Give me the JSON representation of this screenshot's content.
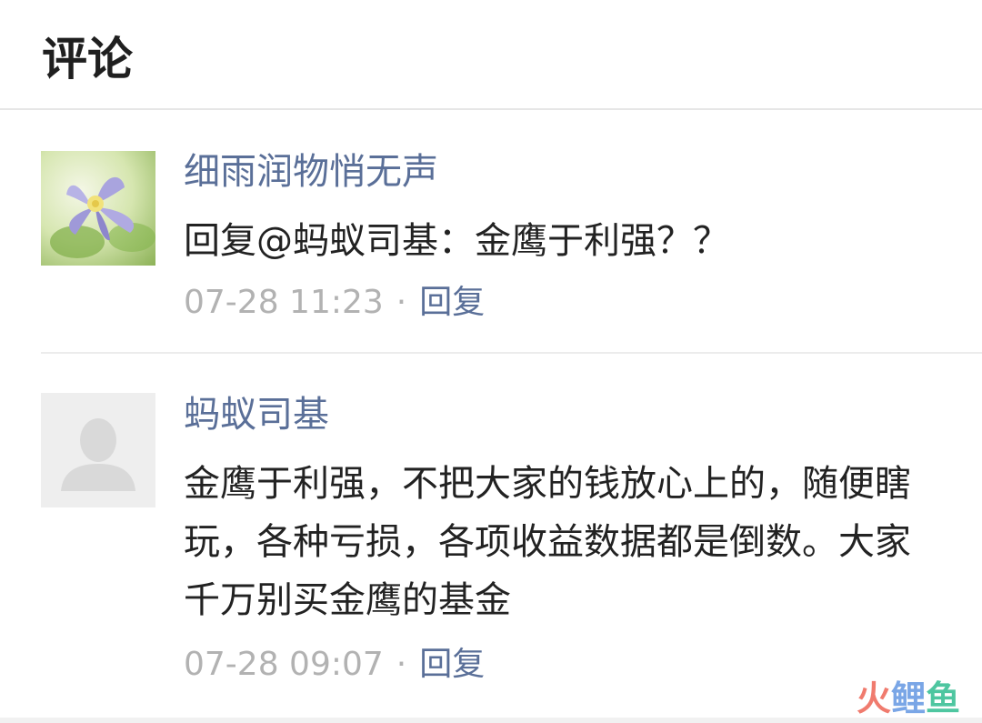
{
  "header": {
    "title": "评论"
  },
  "comments": [
    {
      "nickname": "细雨润物悄无声",
      "content": "回复@蚂蚁司基：金鹰于利强？？",
      "time": "07-28 11:23",
      "separator": "·",
      "reply_label": "回复",
      "avatar_icon": "flower-avatar-icon"
    },
    {
      "nickname": "蚂蚁司基",
      "content": "金鹰于利强，不把大家的钱放心上的，随便瞎玩，各种亏损，各项收益数据都是倒数。大家千万别买金鹰的基金",
      "time": "07-28 09:07",
      "separator": "·",
      "reply_label": "回复",
      "avatar_icon": "default-user-avatar-icon"
    }
  ],
  "watermark": {
    "char1": "火",
    "char2": "鲤",
    "char3": "鱼"
  },
  "colors": {
    "nickname": "#5a6f98",
    "reply": "#5a6f98",
    "time": "#b2b2b2",
    "text": "#222222"
  }
}
